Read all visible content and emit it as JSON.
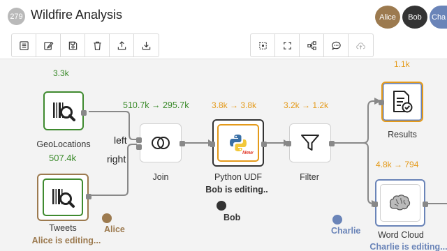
{
  "header": {
    "workflow_id": "279",
    "title": "Wildfire Analysis",
    "users": [
      {
        "name": "Alice",
        "color": "#9c7a4f"
      },
      {
        "name": "Bob",
        "color": "#333333"
      },
      {
        "name": "Cha",
        "color": "#6a84b8"
      }
    ]
  },
  "toolbar": {
    "left_buttons": [
      "list-icon",
      "edit-icon",
      "save-icon",
      "trash-icon",
      "upload-icon",
      "download-icon"
    ],
    "right_buttons": [
      "zoom-fit-icon",
      "fullscreen-icon",
      "layout-icon",
      "comment-icon",
      "cloud-icon"
    ]
  },
  "operators": {
    "geolocations": {
      "label": "GeoLocations",
      "output_count": "3.3k",
      "stat_below": "507.4k",
      "border_color": "#3f8a2f"
    },
    "tweets": {
      "label": "Tweets",
      "editing_status": "Alice is editing...",
      "border_color": "#9c7a4f"
    },
    "join": {
      "label": "Join",
      "stat": "510.7k → 295.7k",
      "port_left": "left",
      "port_right": "right"
    },
    "python_udf": {
      "label": "Python UDF",
      "stat": "3.8k → 3.8k",
      "badge": "New",
      "editing_status": "Bob is editing..",
      "border_color": "#333333"
    },
    "filter": {
      "label": "Filter",
      "stat": "3.2k → 1.2k"
    },
    "results": {
      "label": "Results",
      "stat": "1.1k"
    },
    "word_cloud": {
      "label": "Word Cloud",
      "stat": "4.8k → 794",
      "editing_status": "Charlie is editing...",
      "border_color": "#6a84b8"
    }
  },
  "cursors": {
    "alice": {
      "name": "Alice",
      "color": "#9c7a4f"
    },
    "bob": {
      "name": "Bob",
      "color": "#333333"
    },
    "charlie": {
      "name": "Charlie",
      "color": "#6a84b8"
    }
  },
  "colors": {
    "stat_green": "#3a8a2a",
    "stat_orange": "#e49a1a",
    "canvas_bg": "#f3f3f3"
  }
}
